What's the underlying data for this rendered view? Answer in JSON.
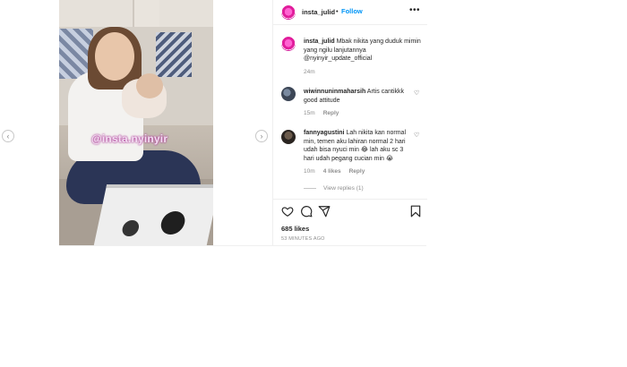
{
  "post": {
    "username": "insta_julid",
    "follow_label": "Follow",
    "dot": "•",
    "more": "•••",
    "watermark": "@insta.nyinyir"
  },
  "caption": {
    "username": "insta_julid",
    "text": "Mbak nikita yang duduk mimin yang ngilu lanjutannya",
    "mention": "@nyinyir_update_official",
    "time": "24m"
  },
  "comments": [
    {
      "username": "wiwinnuninmaharsih",
      "text": "Artis cantikkk good attitude",
      "time": "15m",
      "reply": "Reply"
    },
    {
      "username": "fannyagustini",
      "text": "Lah nikita kan normal min, temen aku lahiran normal 2 hari udah bisa nyuci min 😂 lah aku sc 3 hari udah pegang cucian min 😭",
      "time": "10m",
      "likes": "4 likes",
      "reply": "Reply",
      "view_replies": "View replies (1)"
    }
  ],
  "footer": {
    "likes": "685 likes",
    "ago": "53 MINUTES AGO"
  },
  "nav": {
    "left": "‹",
    "right": "›"
  },
  "colors": {
    "link": "#0095f6",
    "brand": "#d6249f",
    "muted": "#8e8e8e"
  },
  "icons": [
    "heart-icon",
    "comment-icon",
    "share-icon",
    "bookmark-icon",
    "more-options-icon"
  ]
}
